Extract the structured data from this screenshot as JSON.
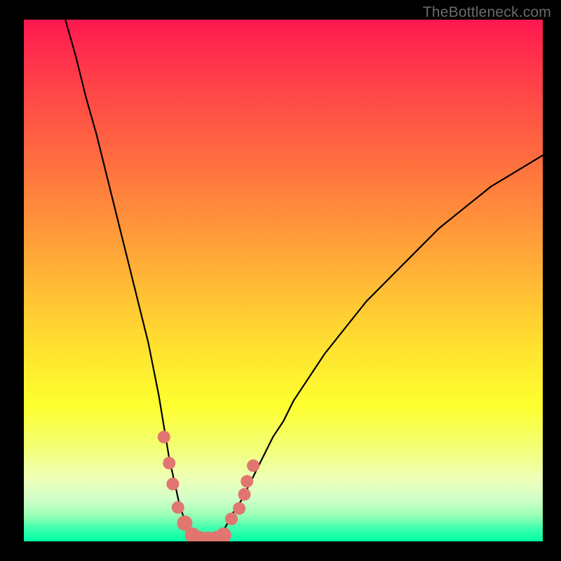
{
  "watermark": "TheBottleneck.com",
  "chart_data": {
    "type": "line",
    "title": "",
    "xlabel": "",
    "ylabel": "",
    "xlim": [
      0,
      100
    ],
    "ylim": [
      0,
      100
    ],
    "grid": false,
    "series": [
      {
        "name": "bottleneck-curve",
        "x": [
          8,
          10,
          12,
          14,
          16,
          18,
          20,
          22,
          24,
          26,
          27,
          28,
          30,
          31,
          32,
          33,
          34,
          35,
          36,
          37,
          38,
          39,
          40,
          42,
          44,
          46,
          48,
          50,
          52,
          54,
          56,
          58,
          62,
          66,
          70,
          75,
          80,
          85,
          90,
          95,
          100
        ],
        "y": [
          100,
          93,
          85,
          78,
          70,
          62,
          54,
          46,
          38,
          28,
          22,
          16,
          7,
          4,
          2,
          1,
          0.5,
          0.4,
          0.4,
          0.5,
          1.5,
          3,
          5,
          8,
          12,
          16,
          20,
          23,
          27,
          30,
          33,
          36,
          41,
          46,
          50,
          55,
          60,
          64,
          68,
          71,
          74
        ]
      }
    ],
    "markers": [
      {
        "x": 27.0,
        "y": 20
      },
      {
        "x": 28.0,
        "y": 15
      },
      {
        "x": 28.7,
        "y": 11
      },
      {
        "x": 29.7,
        "y": 6.5
      },
      {
        "x": 31.0,
        "y": 3.5
      },
      {
        "x": 32.5,
        "y": 1.2
      },
      {
        "x": 34.0,
        "y": 0.5
      },
      {
        "x": 35.5,
        "y": 0.4
      },
      {
        "x": 37.0,
        "y": 0.5
      },
      {
        "x": 38.5,
        "y": 1.2
      },
      {
        "x": 40.0,
        "y": 4.3
      },
      {
        "x": 41.5,
        "y": 6.3
      },
      {
        "x": 42.5,
        "y": 9
      },
      {
        "x": 43.0,
        "y": 11.5
      },
      {
        "x": 44.2,
        "y": 14.5
      }
    ],
    "marker_color": "#e0766f",
    "curve_color": "#000000"
  }
}
